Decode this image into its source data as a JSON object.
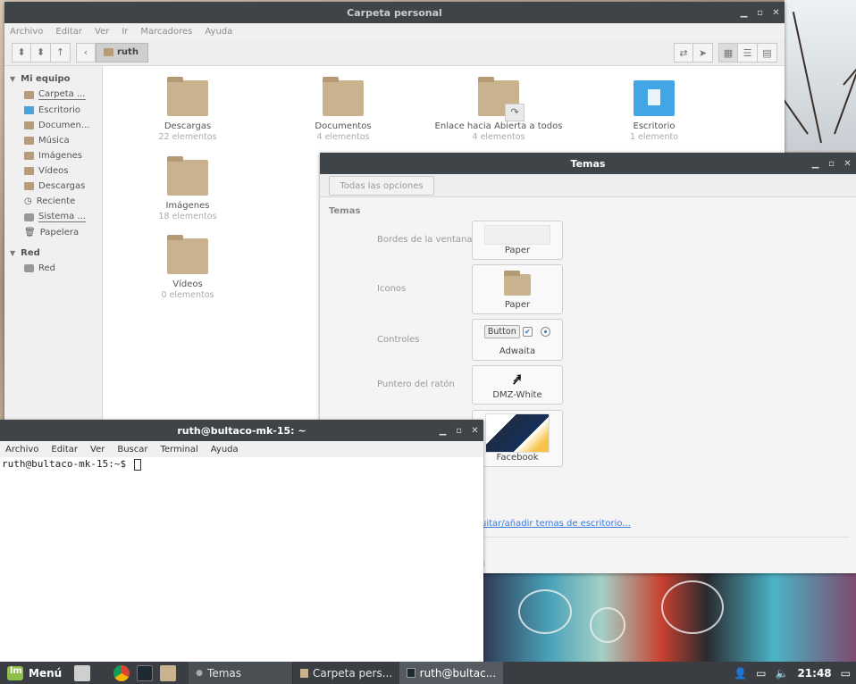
{
  "file_manager": {
    "title": "Carpeta personal",
    "menu": [
      "Archivo",
      "Editar",
      "Ver",
      "Ir",
      "Marcadores",
      "Ayuda"
    ],
    "breadcrumb": "ruth",
    "sidebar": {
      "sections": [
        {
          "label": "Mi equipo",
          "items": [
            "Carpeta ...",
            "Escritorio",
            "Documen...",
            "Música",
            "Imágenes",
            "Vídeos",
            "Descargas",
            "Reciente",
            "Sistema ...",
            "Papelera"
          ]
        },
        {
          "label": "Red",
          "items": [
            "Red"
          ]
        }
      ]
    },
    "files": [
      {
        "name": "Descargas",
        "count": "22 elementos"
      },
      {
        "name": "Documentos",
        "count": "4 elementos"
      },
      {
        "name": "Enlace hacia Abierta a todos",
        "count": "4 elementos"
      },
      {
        "name": "Escritorio",
        "count": "1 elemento"
      },
      {
        "name": "Imágenes",
        "count": "18 elementos"
      },
      {
        "name": "Vídeos",
        "count": "0 elementos"
      }
    ]
  },
  "themes": {
    "title": "Temas",
    "all_options": "Todas las opciones",
    "section": "Temas",
    "rows": [
      {
        "label": "Bordes de la ventana",
        "value": "Paper"
      },
      {
        "label": "Iconos",
        "value": "Paper"
      },
      {
        "label": "Controles",
        "value": "Adwaita"
      },
      {
        "label": "Puntero del ratón",
        "value": "DMZ-White"
      },
      {
        "label": "",
        "value": "Facebook"
      }
    ],
    "controls_preview_button": "Button",
    "link": "uitar/añadir temas de escritorio...",
    "faint_text": [
      "s",
      "es"
    ]
  },
  "terminal": {
    "title": "ruth@bultaco-mk-15: ~",
    "menu": [
      "Archivo",
      "Editar",
      "Ver",
      "Buscar",
      "Terminal",
      "Ayuda"
    ],
    "prompt": "ruth@bultaco-mk-15:~$ "
  },
  "taskbar": {
    "menu_label": "Menú",
    "tasks": [
      "Temas",
      "Carpeta pers...",
      "ruth@bultac..."
    ],
    "clock": "21:48"
  },
  "icons": {
    "accent": "#42a5e6",
    "folder": "#c9b38f",
    "titlebar": "#3f4448"
  }
}
